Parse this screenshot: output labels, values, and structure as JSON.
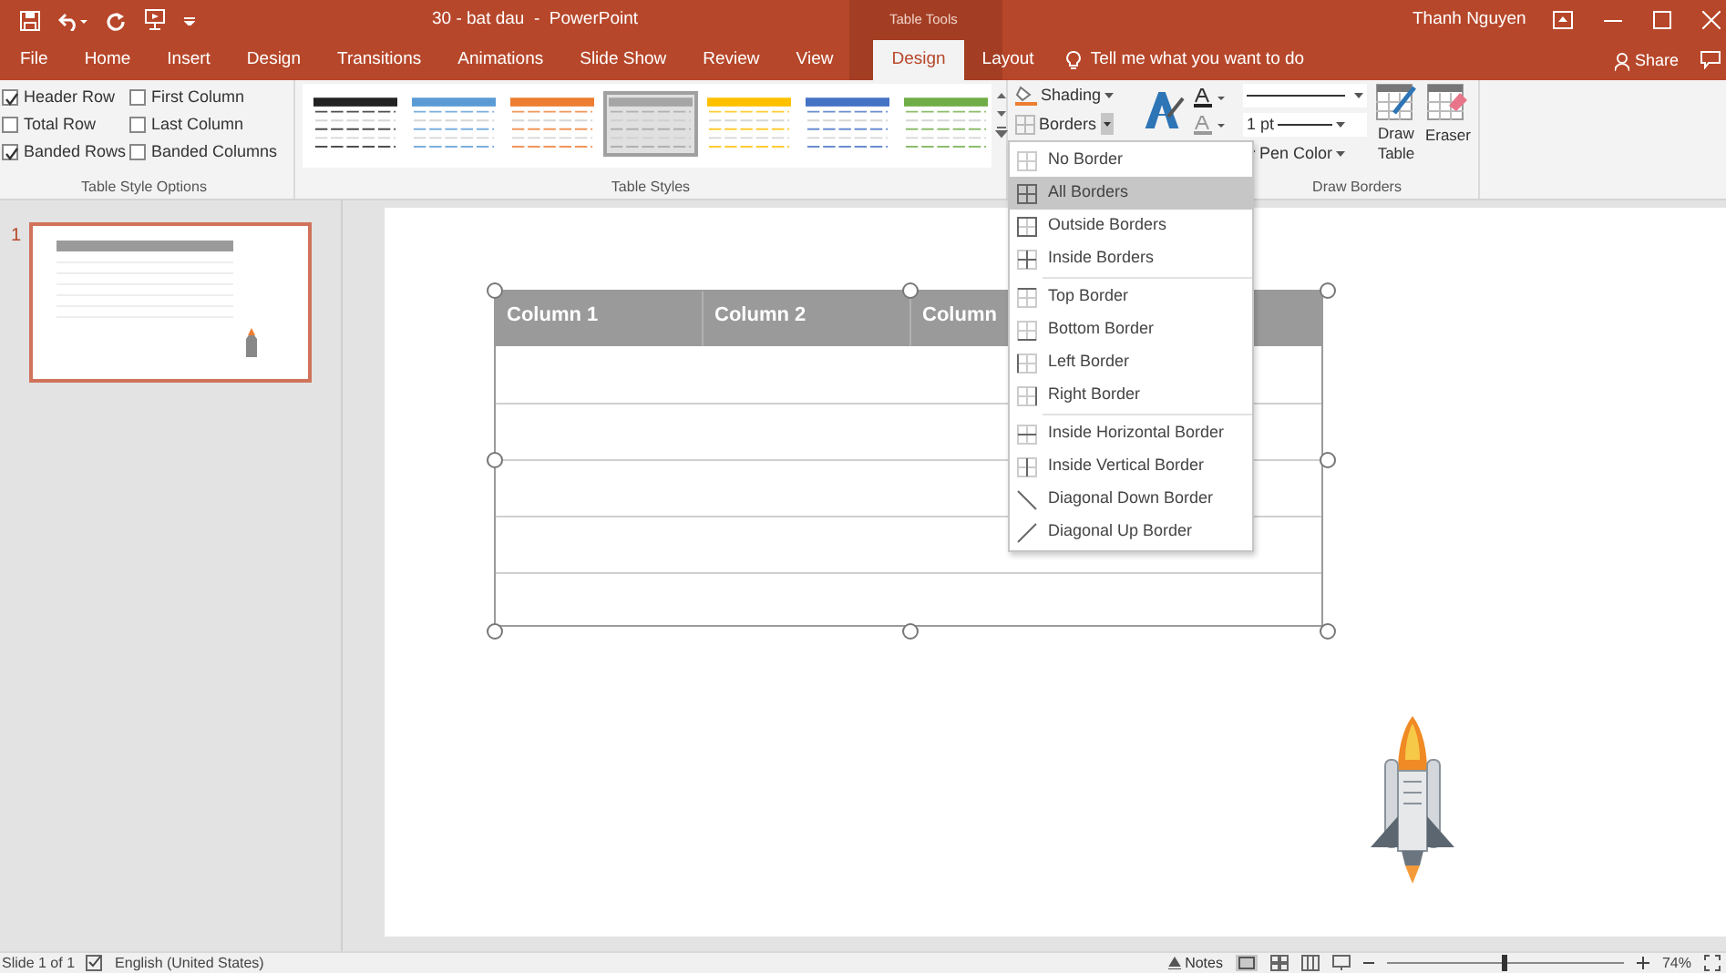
{
  "window": {
    "title": "30 - bat dau  -  PowerPoint",
    "context_label": "Table Tools",
    "user": "Thanh Nguyen"
  },
  "tabs": [
    {
      "label": "File",
      "selected": false
    },
    {
      "label": "Home",
      "selected": false
    },
    {
      "label": "Insert",
      "selected": false
    },
    {
      "label": "Design",
      "selected": false
    },
    {
      "label": "Transitions",
      "selected": false
    },
    {
      "label": "Animations",
      "selected": false
    },
    {
      "label": "Slide Show",
      "selected": false
    },
    {
      "label": "Review",
      "selected": false
    },
    {
      "label": "View",
      "selected": false
    },
    {
      "label": "Design",
      "selected": true
    },
    {
      "label": "Layout",
      "selected": false
    }
  ],
  "tell_me": {
    "placeholder": "Tell me what you want to do"
  },
  "share": "Share",
  "style_options": {
    "group_label": "Table Style Options",
    "items": [
      {
        "label": "Header Row",
        "checked": true
      },
      {
        "label": "First Column",
        "checked": false
      },
      {
        "label": "Total Row",
        "checked": false
      },
      {
        "label": "Last Column",
        "checked": false
      },
      {
        "label": "Banded Rows",
        "checked": true
      },
      {
        "label": "Banded Columns",
        "checked": false
      }
    ]
  },
  "table_styles": {
    "group_label": "Table Styles",
    "items": [
      {
        "color": "#222222",
        "selected": false
      },
      {
        "color": "#5b9bd5",
        "selected": false
      },
      {
        "color": "#ed7d31",
        "selected": false
      },
      {
        "color": "#a5a5a5",
        "selected": true
      },
      {
        "color": "#ffc000",
        "selected": false
      },
      {
        "color": "#4472c4",
        "selected": false
      },
      {
        "color": "#70ad47",
        "selected": false
      }
    ]
  },
  "shading": "Shading",
  "borders": "Borders",
  "draw_borders": {
    "group_label": "Draw Borders",
    "pen_weight": "1 pt",
    "pen_color": "Pen Color",
    "draw_table": "Draw Table",
    "eraser": "Eraser"
  },
  "slides": [
    {
      "number": "1",
      "selected": true
    }
  ],
  "table": {
    "columns": [
      "Column 1",
      "Column 2",
      "Column"
    ]
  },
  "borders_menu": {
    "groups": [
      [
        {
          "label": "No Border",
          "kind": "none",
          "selected": false
        },
        {
          "label": "All Borders",
          "kind": "all",
          "selected": true
        },
        {
          "label": "Outside Borders",
          "kind": "outside",
          "selected": false
        },
        {
          "label": "Inside Borders",
          "kind": "inside",
          "selected": false
        }
      ],
      [
        {
          "label": "Top Border",
          "kind": "top",
          "selected": false
        },
        {
          "label": "Bottom Border",
          "kind": "bottom",
          "selected": false
        },
        {
          "label": "Left Border",
          "kind": "left",
          "selected": false
        },
        {
          "label": "Right Border",
          "kind": "right",
          "selected": false
        }
      ],
      [
        {
          "label": "Inside Horizontal Border",
          "kind": "horizontal",
          "selected": false
        },
        {
          "label": "Inside Vertical Border",
          "kind": "vertical",
          "selected": false
        },
        {
          "label": "Diagonal Down Border",
          "kind": "diagdown",
          "selected": false
        },
        {
          "label": "Diagonal Up Border",
          "kind": "diagup",
          "selected": false
        }
      ]
    ]
  },
  "status_bar": {
    "slide": "Slide 1 of 1",
    "language": "English (United States)",
    "notes": "Notes",
    "zoom": "74%",
    "zoom_slider": {
      "level": 0.5
    }
  }
}
